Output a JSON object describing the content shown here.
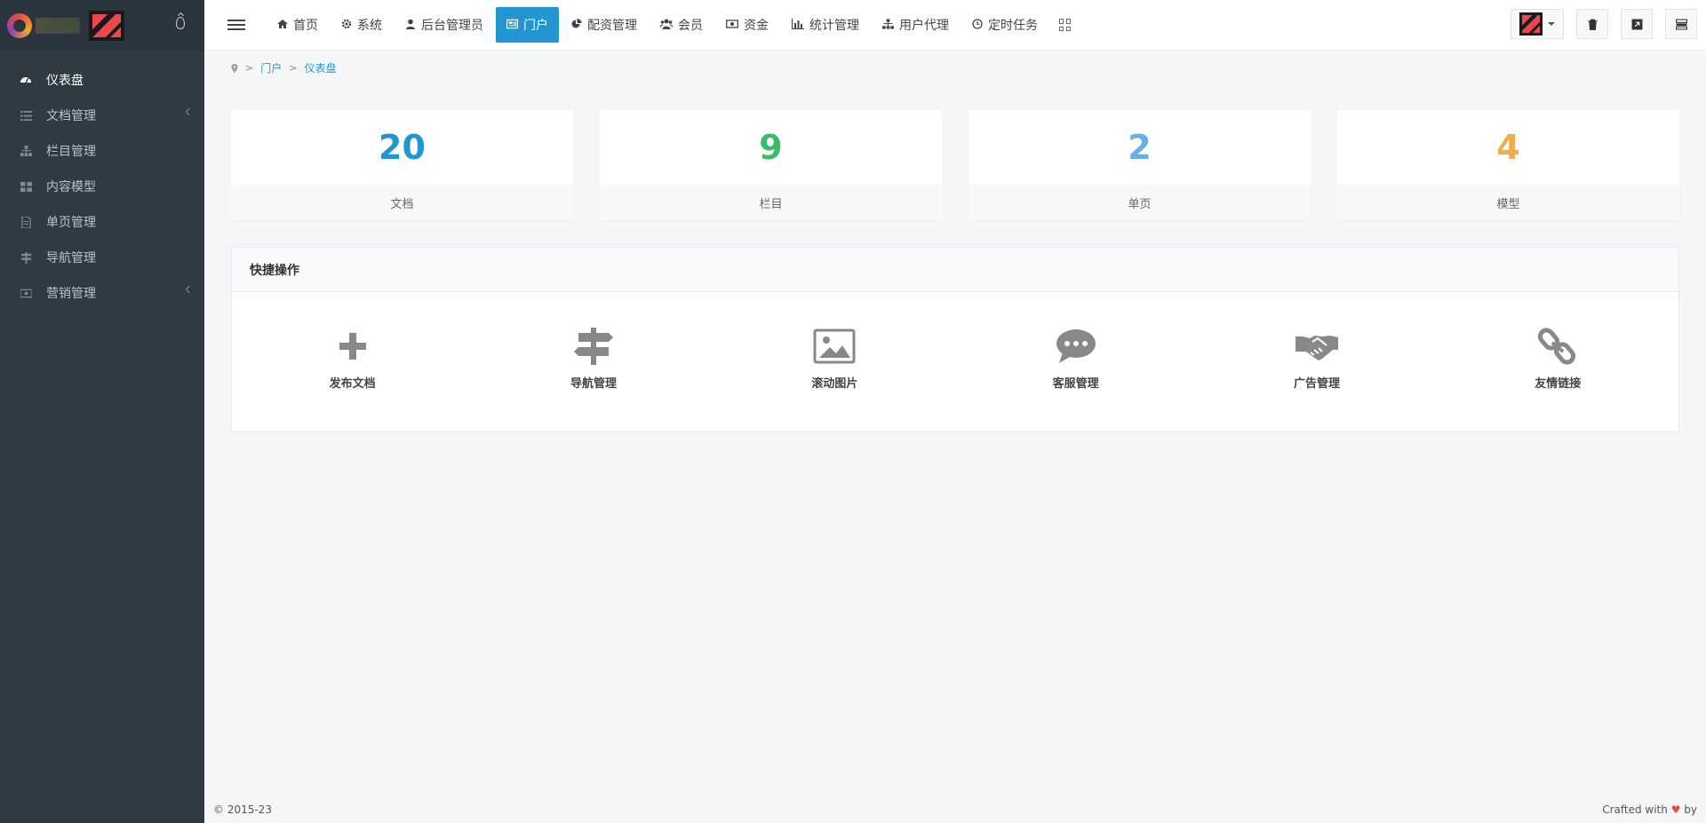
{
  "sidebar": {
    "items": [
      {
        "label": "仪表盘",
        "icon": "dashboard-icon",
        "active": true
      },
      {
        "label": "文档管理",
        "icon": "list-icon",
        "has_children": true
      },
      {
        "label": "栏目管理",
        "icon": "sitemap-icon"
      },
      {
        "label": "内容模型",
        "icon": "grid-icon"
      },
      {
        "label": "单页管理",
        "icon": "file-icon"
      },
      {
        "label": "导航管理",
        "icon": "signpost-icon"
      },
      {
        "label": "营销管理",
        "icon": "money-icon",
        "has_children": true
      }
    ]
  },
  "topnav": {
    "items": [
      {
        "label": "首页",
        "icon": "home-icon"
      },
      {
        "label": "系统",
        "icon": "gear-icon"
      },
      {
        "label": "后台管理员",
        "icon": "user-icon"
      },
      {
        "label": "门户",
        "icon": "newspaper-icon",
        "active": true
      },
      {
        "label": "配资管理",
        "icon": "pie-chart-icon"
      },
      {
        "label": "会员",
        "icon": "users-icon"
      },
      {
        "label": "资金",
        "icon": "money-icon"
      },
      {
        "label": "统计管理",
        "icon": "bar-chart-icon"
      },
      {
        "label": "用户代理",
        "icon": "sitemap-icon"
      },
      {
        "label": "定时任务",
        "icon": "clock-icon"
      }
    ]
  },
  "breadcrumb": {
    "items": [
      "门户",
      "仪表盘"
    ]
  },
  "stats": [
    {
      "value": "20",
      "label": "文档",
      "color": "#2196d3"
    },
    {
      "value": "9",
      "label": "栏目",
      "color": "#3cb96b"
    },
    {
      "value": "2",
      "label": "单页",
      "color": "#6aaee8"
    },
    {
      "value": "4",
      "label": "模型",
      "color": "#f0ad4e"
    }
  ],
  "quick": {
    "title": "快捷操作",
    "items": [
      {
        "label": "发布文档",
        "icon": "plus-icon"
      },
      {
        "label": "导航管理",
        "icon": "signpost-icon"
      },
      {
        "label": "滚动图片",
        "icon": "image-icon"
      },
      {
        "label": "客服管理",
        "icon": "chat-icon"
      },
      {
        "label": "广告管理",
        "icon": "handshake-icon"
      },
      {
        "label": "友情链接",
        "icon": "link-icon"
      }
    ]
  },
  "footer": {
    "copyright": "© 2015-23",
    "crafted_prefix": "Crafted with",
    "crafted_suffix": "by"
  },
  "colors": {
    "accent": "#2196d3",
    "sidebar_bg": "#2f3a43"
  }
}
